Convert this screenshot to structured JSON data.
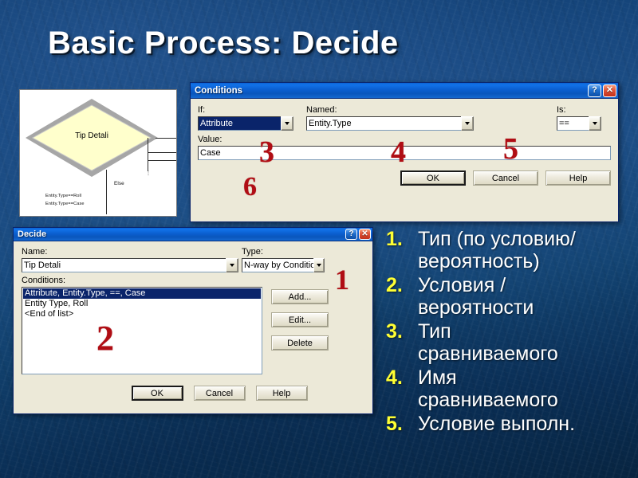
{
  "slide": {
    "title": "Basic Process: Decide",
    "accent_blue": "#0a246a",
    "titlebar_blue": "#0b5fd0",
    "bullet_number_color": "#ffff33",
    "annotation_color": "#b00d14",
    "background_color": "#16467c"
  },
  "flowchart": {
    "diamond_label": "Tip Detali",
    "diamond_fill": "#ffffcc",
    "diamond_border": "#a6a6a6",
    "else_label": "Else",
    "condition_labels": [
      "Entity.Type==Roll",
      "Entity.Type==Case"
    ],
    "dots": "⋮"
  },
  "conditions_dialog": {
    "title": "Conditions",
    "help_button": "?",
    "close_button": "✕",
    "if": {
      "label": "If:",
      "value": "Attribute",
      "selected": true
    },
    "named": {
      "label": "Named:",
      "value": "Entity.Type"
    },
    "is": {
      "label": "Is:",
      "value": "=="
    },
    "value": {
      "label": "Value:",
      "value": "Case"
    },
    "buttons": {
      "ok": "OK",
      "cancel": "Cancel",
      "help": "Help"
    },
    "annotations": {
      "if": "3",
      "named": "4",
      "is": "5",
      "value": "6"
    }
  },
  "decide_dialog": {
    "title": "Decide",
    "help_button": "?",
    "close_button": "✕",
    "name": {
      "label": "Name:",
      "value": "Tip Detali",
      "selected": true
    },
    "type": {
      "label": "Type:",
      "value": "N-way by Condition"
    },
    "conditions": {
      "label": "Conditions:",
      "items": [
        {
          "text": "Attribute, Entity.Type, ==, Case",
          "selected": true
        },
        {
          "text": "Entity Type, Roll",
          "selected": false
        },
        {
          "text": "<End of list>",
          "selected": false
        }
      ]
    },
    "side_buttons": {
      "add": "Add...",
      "edit": "Edit...",
      "delete": "Delete"
    },
    "buttons": {
      "ok": "OK",
      "cancel": "Cancel",
      "help": "Help"
    },
    "annotations": {
      "type": "1",
      "conditions": "2"
    }
  },
  "bullets": [
    {
      "num": "1.",
      "lines": [
        "Тип (по условию/",
        "вероятность)"
      ]
    },
    {
      "num": "2.",
      "lines": [
        "Условия /",
        "вероятности"
      ]
    },
    {
      "num": "3.",
      "lines": [
        "Тип",
        "сравниваемого"
      ]
    },
    {
      "num": "4.",
      "lines": [
        "Имя",
        "сравниваемого"
      ]
    },
    {
      "num": "5.",
      "lines": [
        "Условие выполн."
      ]
    }
  ]
}
